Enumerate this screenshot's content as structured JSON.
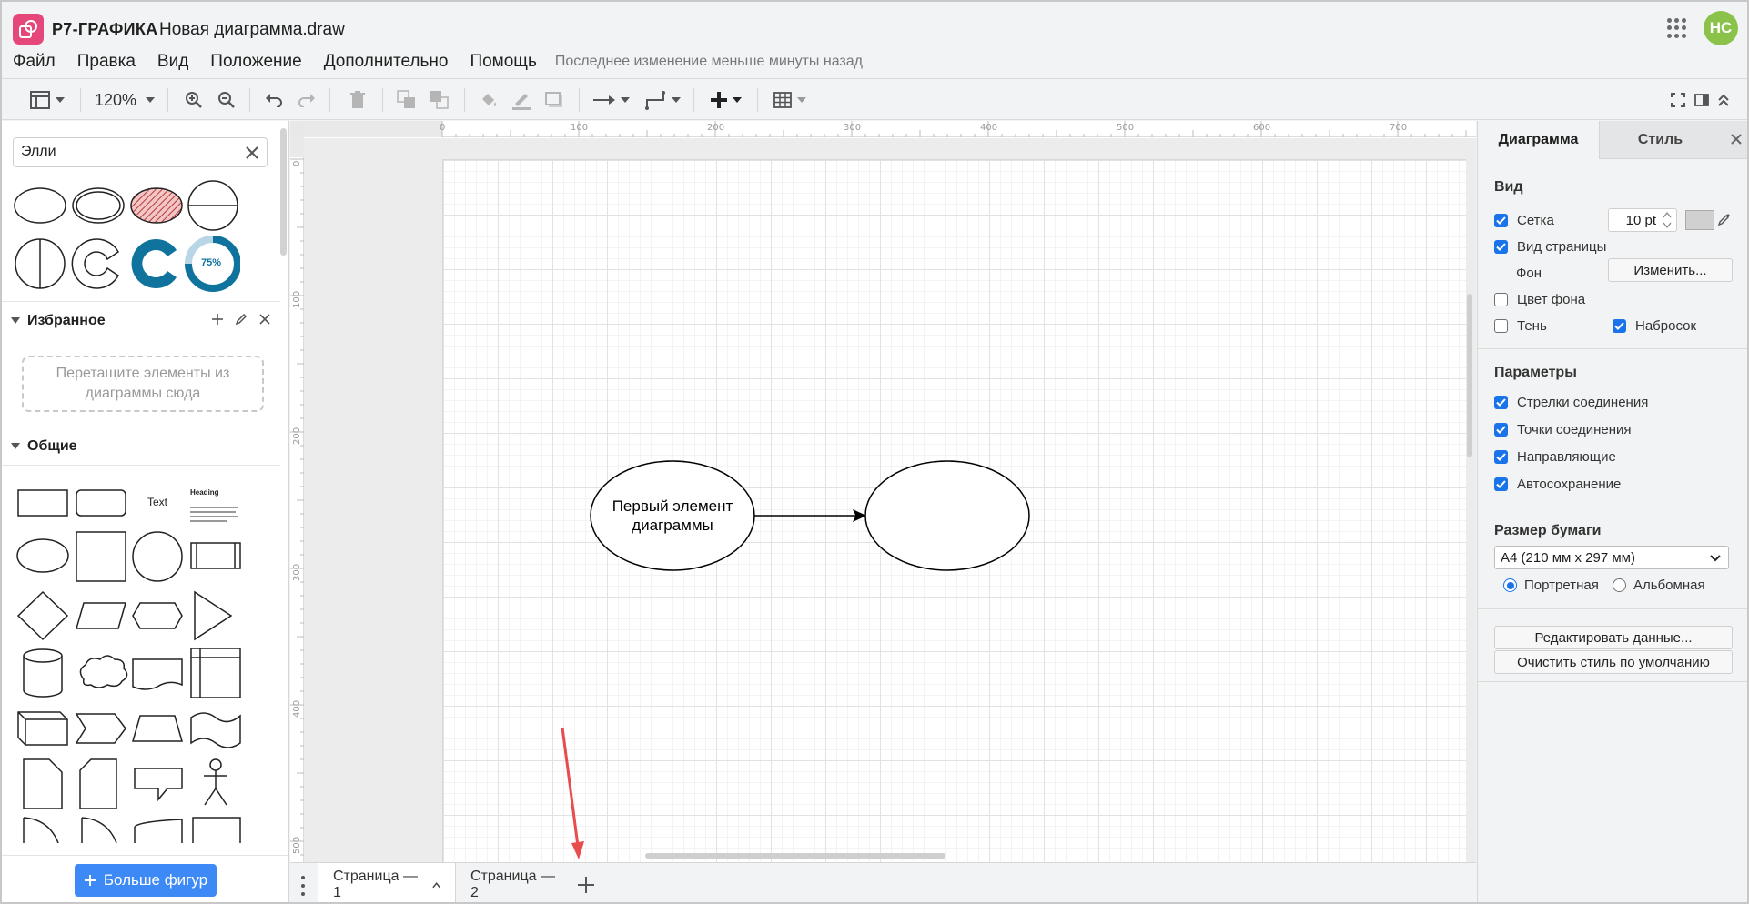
{
  "app": {
    "name": "Р7-ГРАФИКА",
    "document": "Новая диаграмма.draw",
    "avatar_initials": "НС",
    "colors": {
      "logo": "#e5477a",
      "avatar": "#8bc34a",
      "accent": "#1a73e8",
      "more_shapes_button": "#3d8af7",
      "annotation_arrow": "#e84c4c"
    }
  },
  "menu": {
    "items": [
      "Файл",
      "Правка",
      "Вид",
      "Положение",
      "Дополнительно",
      "Помощь"
    ],
    "last_change": "Последнее изменение меньше минуты назад"
  },
  "toolbar": {
    "zoom": "120%",
    "icons": [
      "layout-icon",
      "zoom-in-icon",
      "zoom-out-icon",
      "undo-icon",
      "redo-icon",
      "delete-icon",
      "to-front-icon",
      "to-back-icon",
      "fill-color-icon",
      "line-color-icon",
      "shadow-icon",
      "connection-icon",
      "waypoints-icon",
      "insert-icon",
      "table-icon",
      "fullscreen-icon",
      "format-panel-icon",
      "collapse-icon"
    ]
  },
  "left_panel": {
    "search_value": "Элли",
    "favorites": {
      "title": "Избранное",
      "drop_hint": "Перетащите элементы из диаграммы сюда"
    },
    "general": {
      "title": "Общие",
      "text_shape": "Text",
      "heading_shape": "Heading"
    },
    "search_result_badge": "75%",
    "more_shapes": "Больше фигур"
  },
  "canvas": {
    "ruler_top": [
      "0",
      "100",
      "200",
      "300",
      "400",
      "500",
      "600",
      "700"
    ],
    "ruler_left": [
      "0",
      "100",
      "200",
      "300",
      "400",
      "500"
    ],
    "shapes": {
      "ellipse1_text": "Первый элемент диаграммы",
      "ellipse2_text": ""
    }
  },
  "pages": {
    "tabs": [
      "Страница — 1",
      "Страница — 2"
    ],
    "active": 0
  },
  "right_panel": {
    "tabs": [
      "Диаграмма",
      "Стиль"
    ],
    "view": {
      "title": "Вид",
      "grid": "Сетка",
      "grid_checked": true,
      "grid_size": "10 pt",
      "page_view": "Вид страницы",
      "page_view_checked": true,
      "background": "Фон",
      "change_button": "Изменить...",
      "background_color": "Цвет фона",
      "background_color_checked": false,
      "shadow": "Тень",
      "shadow_checked": false,
      "sketch": "Набросок",
      "sketch_checked": true
    },
    "options": {
      "title": "Параметры",
      "items": [
        {
          "label": "Стрелки соединения",
          "checked": true
        },
        {
          "label": "Точки соединения",
          "checked": true
        },
        {
          "label": "Направляющие",
          "checked": true
        },
        {
          "label": "Автосохранение",
          "checked": true
        }
      ]
    },
    "paper": {
      "title": "Размер бумаги",
      "size": "A4 (210 мм x 297 мм)",
      "portrait": "Портретная",
      "landscape": "Альбомная",
      "orientation": "portrait"
    },
    "edit_data": "Редактировать данные...",
    "clear_style": "Очистить стиль по умолчанию"
  }
}
